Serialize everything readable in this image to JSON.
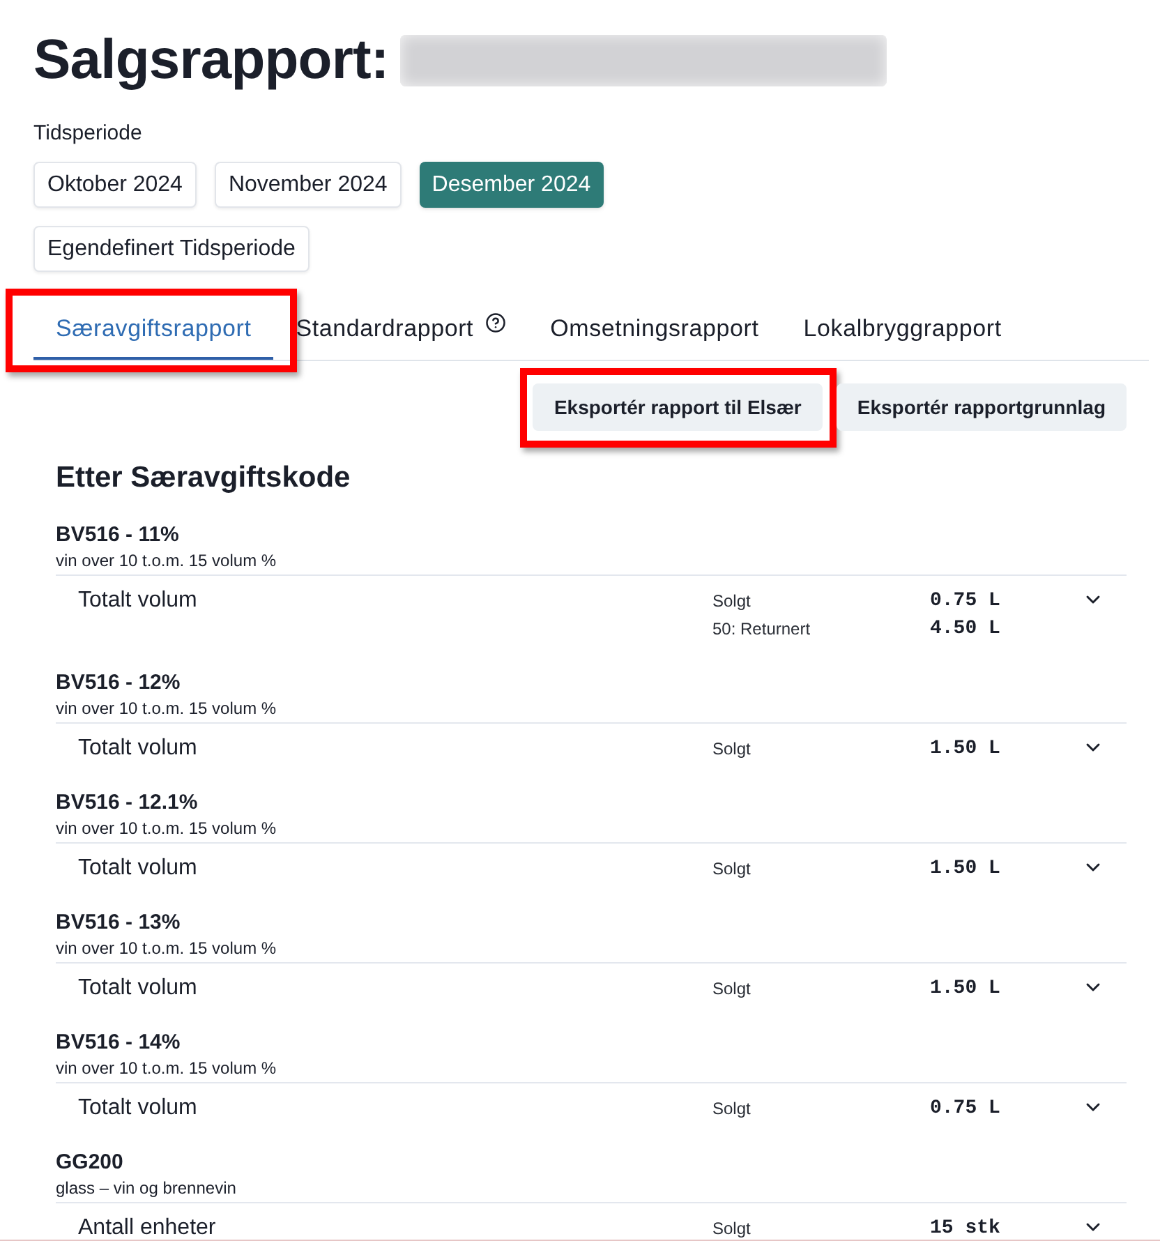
{
  "page_title": "Salgsrapport:",
  "period": {
    "label": "Tidsperiode",
    "options": [
      {
        "label": "Oktober 2024",
        "selected": false
      },
      {
        "label": "November 2024",
        "selected": false
      },
      {
        "label": "Desember 2024",
        "selected": true
      },
      {
        "label": "Egendefinert Tidsperiode",
        "selected": false
      }
    ]
  },
  "tabs": [
    {
      "label": "Særavgiftsrapport",
      "selected": true,
      "help_icon": false,
      "annotated": true
    },
    {
      "label": "Standardrapport",
      "selected": false,
      "help_icon": true,
      "annotated": false
    },
    {
      "label": "Omsetningsrapport",
      "selected": false,
      "help_icon": false,
      "annotated": false
    },
    {
      "label": "Lokalbryggrapport",
      "selected": false,
      "help_icon": false,
      "annotated": false
    }
  ],
  "actions": [
    {
      "label": "Eksportér rapport til Elsær",
      "annotated": true
    },
    {
      "label": "Eksportér rapportgrunnlag",
      "annotated": false
    }
  ],
  "section": {
    "title": "Etter Særavgiftskode",
    "groups": [
      {
        "code": "BV516 - 11%",
        "description": "vin over 10 t.o.m. 15 volum %",
        "rows": [
          {
            "label": "Totalt volum",
            "expanded": false,
            "entries": [
              {
                "type": "Solgt",
                "value": "0.75 L"
              },
              {
                "type": "50: Returnert",
                "value": "4.50 L"
              }
            ]
          }
        ]
      },
      {
        "code": "BV516 - 12%",
        "description": "vin over 10 t.o.m. 15 volum %",
        "rows": [
          {
            "label": "Totalt volum",
            "expanded": false,
            "entries": [
              {
                "type": "Solgt",
                "value": "1.50 L"
              }
            ]
          }
        ]
      },
      {
        "code": "BV516 - 12.1%",
        "description": "vin over 10 t.o.m. 15 volum %",
        "rows": [
          {
            "label": "Totalt volum",
            "expanded": false,
            "entries": [
              {
                "type": "Solgt",
                "value": "1.50 L"
              }
            ]
          }
        ]
      },
      {
        "code": "BV516 - 13%",
        "description": "vin over 10 t.o.m. 15 volum %",
        "rows": [
          {
            "label": "Totalt volum",
            "expanded": false,
            "entries": [
              {
                "type": "Solgt",
                "value": "1.50 L"
              }
            ]
          }
        ]
      },
      {
        "code": "BV516 - 14%",
        "description": "vin over 10 t.o.m. 15 volum %",
        "rows": [
          {
            "label": "Totalt volum",
            "expanded": false,
            "entries": [
              {
                "type": "Solgt",
                "value": "0.75 L"
              }
            ]
          }
        ]
      },
      {
        "code": "GG200",
        "description": "glass – vin og brennevin",
        "rows": [
          {
            "label": "Antall enheter",
            "expanded": false,
            "entries": [
              {
                "type": "Solgt",
                "value": "15 stk"
              }
            ]
          }
        ]
      }
    ]
  }
}
